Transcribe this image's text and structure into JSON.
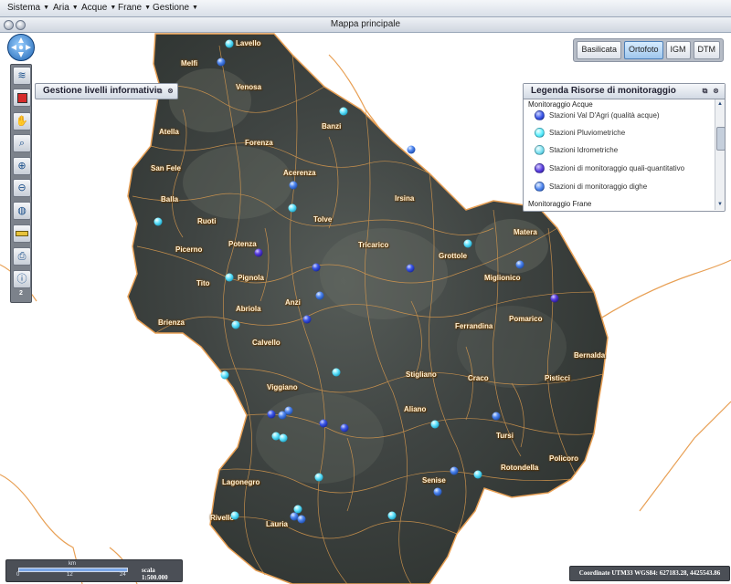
{
  "menu": {
    "items": [
      {
        "label": "Sistema"
      },
      {
        "label": "Aria"
      },
      {
        "label": "Acque"
      },
      {
        "label": "Frane"
      },
      {
        "label": "Gestione"
      }
    ]
  },
  "window": {
    "title": "Mappa principale"
  },
  "basemaps": {
    "buttons": [
      {
        "label": "Basilicata",
        "active": false
      },
      {
        "label": "Ortofoto",
        "active": true
      },
      {
        "label": "IGM",
        "active": false
      },
      {
        "label": "DTM",
        "active": false
      }
    ]
  },
  "toolbar": {
    "badge": "2"
  },
  "layers_panel": {
    "title": "Gestione livelli informativi"
  },
  "legend": {
    "title": "Legenda Risorse di monitoraggio",
    "section_water": "Monitoraggio Acque",
    "items": [
      {
        "label": "Stazioni Val D'Agri (qualità acque)",
        "color": "#3b56e8"
      },
      {
        "label": "Stazioni Pluviometriche",
        "color": "#5ff0ff"
      },
      {
        "label": "Stazioni Idrometriche",
        "color": "#7ee2f2"
      },
      {
        "label": "Stazioni di monitoraggio quali-quantitativo",
        "color": "#5a3fe0"
      },
      {
        "label": "Stazioni di monitoraggio dighe",
        "color": "#4f86f0"
      }
    ],
    "section_landslide": "Monitoraggio Frane"
  },
  "scalebar": {
    "unit": "km",
    "ticks": [
      "0",
      "12",
      "24"
    ],
    "scale": "scala 1:500.000"
  },
  "coordinates": "Coordinate UTM33 WGS84: 627183.28, 4425543.86",
  "places": [
    "Lavello",
    "Melfi",
    "Venosa",
    "Banzi",
    "Atella",
    "Forenza",
    "Acerenza",
    "San Fele",
    "Irsina",
    "Balla",
    "Ruoti",
    "Tolve",
    "Picerno",
    "Potenza",
    "Tricarico",
    "Grottole",
    "Matera",
    "Miglionico",
    "Tito",
    "Pignola",
    "Anzi",
    "Abriola",
    "Pomarico",
    "Brienza",
    "Calvello",
    "Ferrandina",
    "Bernalda",
    "Viggiano",
    "Stigliano",
    "Craco",
    "Pisticci",
    "Aliano",
    "Tursi",
    "Lagonegro",
    "Policoro",
    "Senise",
    "Rotondella",
    "Rivello",
    "Lauria"
  ],
  "colors": {
    "dark_blue": "#3b56e8",
    "cyan": "#6be6ff",
    "violet": "#5a3fe0",
    "mid_blue": "#4f86f0",
    "boundary": "#e8a055"
  }
}
